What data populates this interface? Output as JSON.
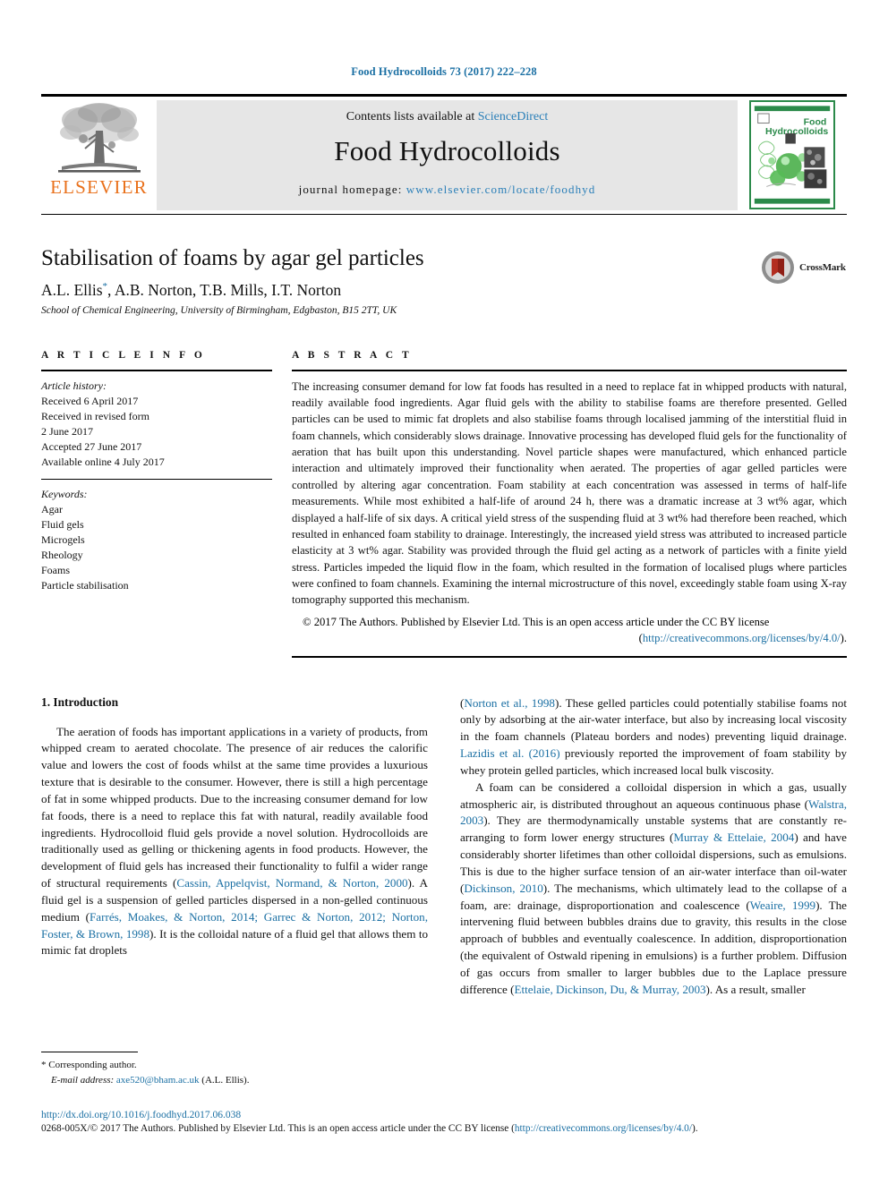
{
  "running_head": "Food Hydrocolloids 73 (2017) 222–228",
  "masthead": {
    "publisher_logo_label": "ELSEVIER",
    "contents_prefix": "Contents lists available at",
    "contents_link": "ScienceDirect",
    "journal_name": "Food Hydrocolloids",
    "homepage_prefix": "journal homepage:",
    "homepage_url": "www.elsevier.com/locate/foodhyd",
    "cover_title_line1": "Food",
    "cover_title_line2": "Hydrocolloids",
    "cover_accent_color": "#2b8a4a",
    "link_color": "#2a7fb8",
    "elsevier_orange": "#E9711C"
  },
  "article": {
    "title": "Stabilisation of foams by agar gel particles",
    "authors": "A.L. Ellis, A.B. Norton, T.B. Mills, I.T. Norton",
    "corresponding_marker": "*",
    "affiliation": "School of Chemical Engineering, University of Birmingham, Edgbaston, B15 2TT, UK",
    "crossmark_label": "CrossMark"
  },
  "article_info": {
    "section_label": "A R T I C L E   I N F O",
    "history_label": "Article history:",
    "history": [
      "Received 6 April 2017",
      "Received in revised form",
      "2 June 2017",
      "Accepted 27 June 2017",
      "Available online 4 July 2017"
    ],
    "keywords_label": "Keywords:",
    "keywords": [
      "Agar",
      "Fluid gels",
      "Microgels",
      "Rheology",
      "Foams",
      "Particle stabilisation"
    ]
  },
  "abstract": {
    "section_label": "A B S T R A C T",
    "body": "The increasing consumer demand for low fat foods has resulted in a need to replace fat in whipped products with natural, readily available food ingredients. Agar fluid gels with the ability to stabilise foams are therefore presented. Gelled particles can be used to mimic fat droplets and also stabilise foams through localised jamming of the interstitial fluid in foam channels, which considerably slows drainage. Innovative processing has developed fluid gels for the functionality of aeration that has built upon this understanding. Novel particle shapes were manufactured, which enhanced particle interaction and ultimately improved their functionality when aerated. The properties of agar gelled particles were controlled by altering agar concentration. Foam stability at each concentration was assessed in terms of half-life measurements. While most exhibited a half-life of around 24 h, there was a dramatic increase at 3 wt% agar, which displayed a half-life of six days. A critical yield stress of the suspending fluid at 3 wt% had therefore been reached, which resulted in enhanced foam stability to drainage. Interestingly, the increased yield stress was attributed to increased particle elasticity at 3 wt% agar. Stability was provided through the fluid gel acting as a network of particles with a finite yield stress. Particles impeded the liquid flow in the foam, which resulted in the formation of localised plugs where particles were confined to foam channels. Examining the internal microstructure of this novel, exceedingly stable foam using X-ray tomography supported this mechanism.",
    "copyright_text": "© 2017 The Authors. Published by Elsevier Ltd. This is an open access article under the CC BY license",
    "license_open": "(",
    "license_url": "http://creativecommons.org/licenses/by/4.0/",
    "license_close": ")."
  },
  "introduction": {
    "heading": "1. Introduction",
    "left_paragraphs": [
      "The aeration of foods has important applications in a variety of products, from whipped cream to aerated chocolate. The presence of air reduces the calorific value and lowers the cost of foods whilst at the same time provides a luxurious texture that is desirable to the consumer. However, there is still a high percentage of fat in some whipped products. Due to the increasing consumer demand for low fat foods, there is a need to replace this fat with natural, readily available food ingredients. Hydrocolloid fluid gels provide a novel solution. Hydrocolloids are traditionally used as gelling or thickening agents in food products. However, the development of fluid gels has increased their functionality to fulfil a wider range of structural requirements (",
      "). A fluid gel is a suspension of gelled particles dispersed in a non-gelled continuous medium (",
      "). It is the colloidal nature of a fluid gel that allows them to mimic fat droplets"
    ],
    "left_citations": [
      "Cassin, Appelqvist, Normand, & Norton, 2000",
      "Farrés, Moakes, & Norton, 2014; Garrec & Norton, 2012; Norton, Foster, & Brown, 1998"
    ],
    "right_p1": {
      "cite_open": "(",
      "cite1": "Norton et al., 1998",
      "text1": "). These gelled particles could potentially stabilise foams not only by adsorbing at the air-water interface, but also by increasing local viscosity in the foam channels (Plateau borders and nodes) preventing liquid drainage. ",
      "cite2": "Lazidis et al. (2016)",
      "text2": " previously reported the improvement of foam stability by whey protein gelled particles, which increased local bulk viscosity."
    },
    "right_p2": {
      "t1": "A foam can be considered a colloidal dispersion in which a gas, usually atmospheric air, is distributed throughout an aqueous continuous phase (",
      "c1": "Walstra, 2003",
      "t2": "). They are thermodynamically unstable systems that are constantly re-arranging to form lower energy structures (",
      "c2": "Murray & Ettelaie, 2004",
      "t3": ") and have considerably shorter lifetimes than other colloidal dispersions, such as emulsions. This is due to the higher surface tension of an air-water interface than oil-water (",
      "c3": "Dickinson, 2010",
      "t4": "). The mechanisms, which ultimately lead to the collapse of a foam, are: drainage, disproportionation and coalescence (",
      "c4": "Weaire, 1999",
      "t5": "). The intervening fluid between bubbles drains due to gravity, this results in the close approach of bubbles and eventually coalescence. In addition, disproportionation (the equivalent of Ostwald ripening in emulsions) is a further problem. Diffusion of gas occurs from smaller to larger bubbles due to the Laplace pressure difference (",
      "c5": "Ettelaie, Dickinson, Du, & Murray, 2003",
      "t6": "). As a result, smaller"
    }
  },
  "footnote": {
    "marker": "*",
    "corresponding": "Corresponding author.",
    "email_label": "E-mail address:",
    "email": "axe520@bham.ac.uk",
    "email_owner": "(A.L. Ellis)."
  },
  "page_footer": {
    "doi": "http://dx.doi.org/10.1016/j.foodhyd.2017.06.038",
    "issn_prefix": "0268-005X/© 2017 The Authors. Published by Elsevier Ltd. This is an open access article under the CC BY license (",
    "license_url": "http://creativecommons.org/licenses/by/4.0/",
    "issn_suffix": ")."
  }
}
